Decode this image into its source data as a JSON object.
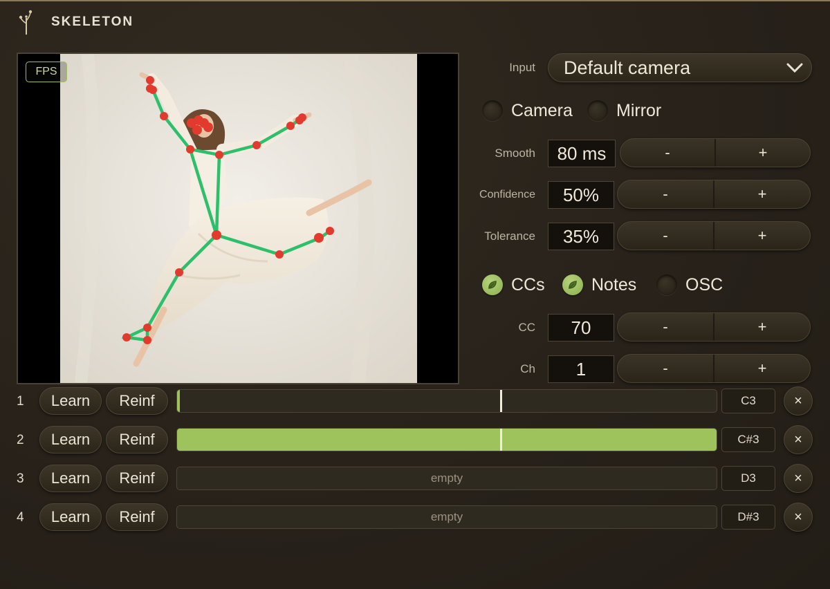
{
  "app": {
    "title": "SKELETON"
  },
  "preview": {
    "fps_label": "FPS"
  },
  "input": {
    "label": "Input",
    "value": "Default camera"
  },
  "toggles1": [
    {
      "label": "Camera",
      "checked": false
    },
    {
      "label": "Mirror",
      "checked": false
    }
  ],
  "smooth": {
    "label": "Smooth",
    "value": "80 ms",
    "minus": "-",
    "plus": "+"
  },
  "confidence": {
    "label": "Confidence",
    "value": "50%",
    "minus": "-",
    "plus": "+"
  },
  "tolerance": {
    "label": "Tolerance",
    "value": "35%",
    "minus": "-",
    "plus": "+"
  },
  "toggles2": [
    {
      "label": "CCs",
      "checked": true
    },
    {
      "label": "Notes",
      "checked": true
    },
    {
      "label": "OSC",
      "checked": false
    }
  ],
  "cc": {
    "label": "CC",
    "value": "70",
    "minus": "-",
    "plus": "+"
  },
  "ch": {
    "label": "Ch",
    "value": "1",
    "minus": "-",
    "plus": "+"
  },
  "slots": [
    {
      "num": "1",
      "learn": "Learn",
      "reinf": "Reinf",
      "level": 0.005,
      "threshold": 0.6,
      "text": "",
      "note": "C3",
      "close": "×"
    },
    {
      "num": "2",
      "learn": "Learn",
      "reinf": "Reinf",
      "level": 1.0,
      "threshold": 0.6,
      "text": "",
      "note": "C#3",
      "close": "×"
    },
    {
      "num": "3",
      "learn": "Learn",
      "reinf": "Reinf",
      "level": 0,
      "threshold": null,
      "text": "empty",
      "note": "D3",
      "close": "×"
    },
    {
      "num": "4",
      "learn": "Learn",
      "reinf": "Reinf",
      "level": 0,
      "threshold": null,
      "text": "empty",
      "note": "D#3",
      "close": "×"
    }
  ],
  "colors": {
    "accent": "#9ec35c",
    "skeleton_line": "#2dbf6a",
    "joint": "#e23b2e"
  }
}
